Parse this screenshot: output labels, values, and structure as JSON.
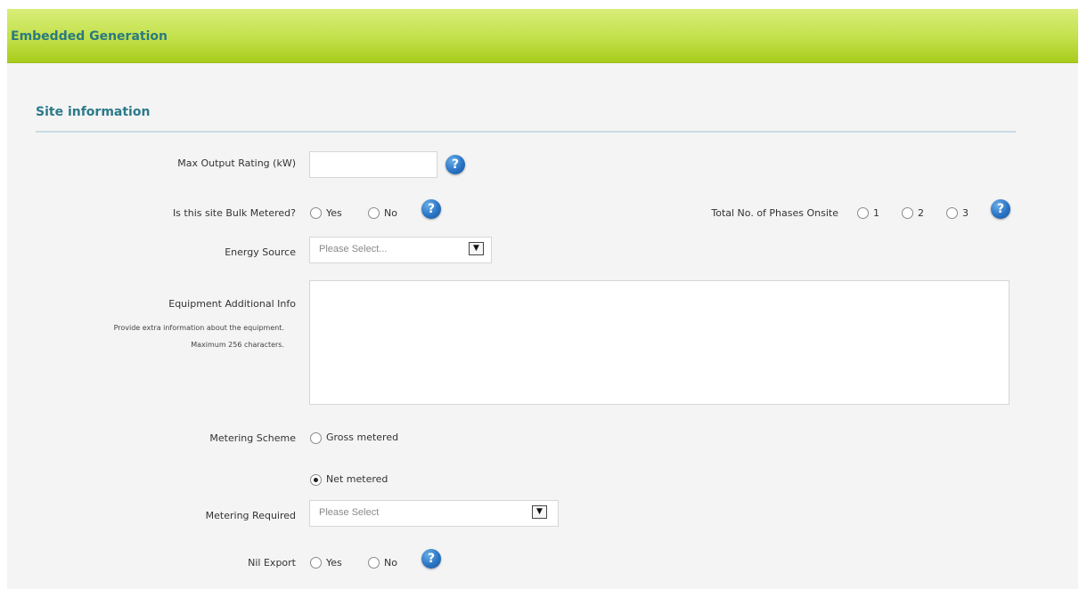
{
  "header": {
    "title": "Embedded Generation"
  },
  "section": {
    "title": "Site information"
  },
  "fields": {
    "max_output": {
      "label": "Max Output Rating (kW)",
      "value": "",
      "help_icon": "help-icon"
    },
    "bulk_metered": {
      "label": "Is this site Bulk Metered?",
      "options": [
        "Yes",
        "No"
      ],
      "selected": ""
    },
    "phases": {
      "label": "Total No. of Phases Onsite",
      "options": [
        "1",
        "2",
        "3"
      ],
      "selected": ""
    },
    "energy_source": {
      "label": "Energy Source",
      "selected": "Please Select..."
    },
    "equipment_info": {
      "label": "Equipment Additional Info",
      "hint_line1": "Provide extra information about the equipment.",
      "hint_line2": "Maximum 256 characters.",
      "value": ""
    },
    "metering_scheme": {
      "label": "Metering Scheme",
      "options": [
        "Gross metered",
        "Net metered"
      ],
      "selected": "Net metered"
    },
    "metering_required": {
      "label": "Metering Required",
      "selected": "Please Select"
    },
    "nil_export": {
      "label": "Nil Export",
      "options": [
        "Yes",
        "No"
      ],
      "selected": ""
    }
  },
  "help_glyph": "?",
  "select_arrow_glyph": "▼",
  "colors": {
    "header_green": "#c3e04a",
    "title_teal": "#2a7a7f",
    "help_blue": "#2a74c4"
  }
}
